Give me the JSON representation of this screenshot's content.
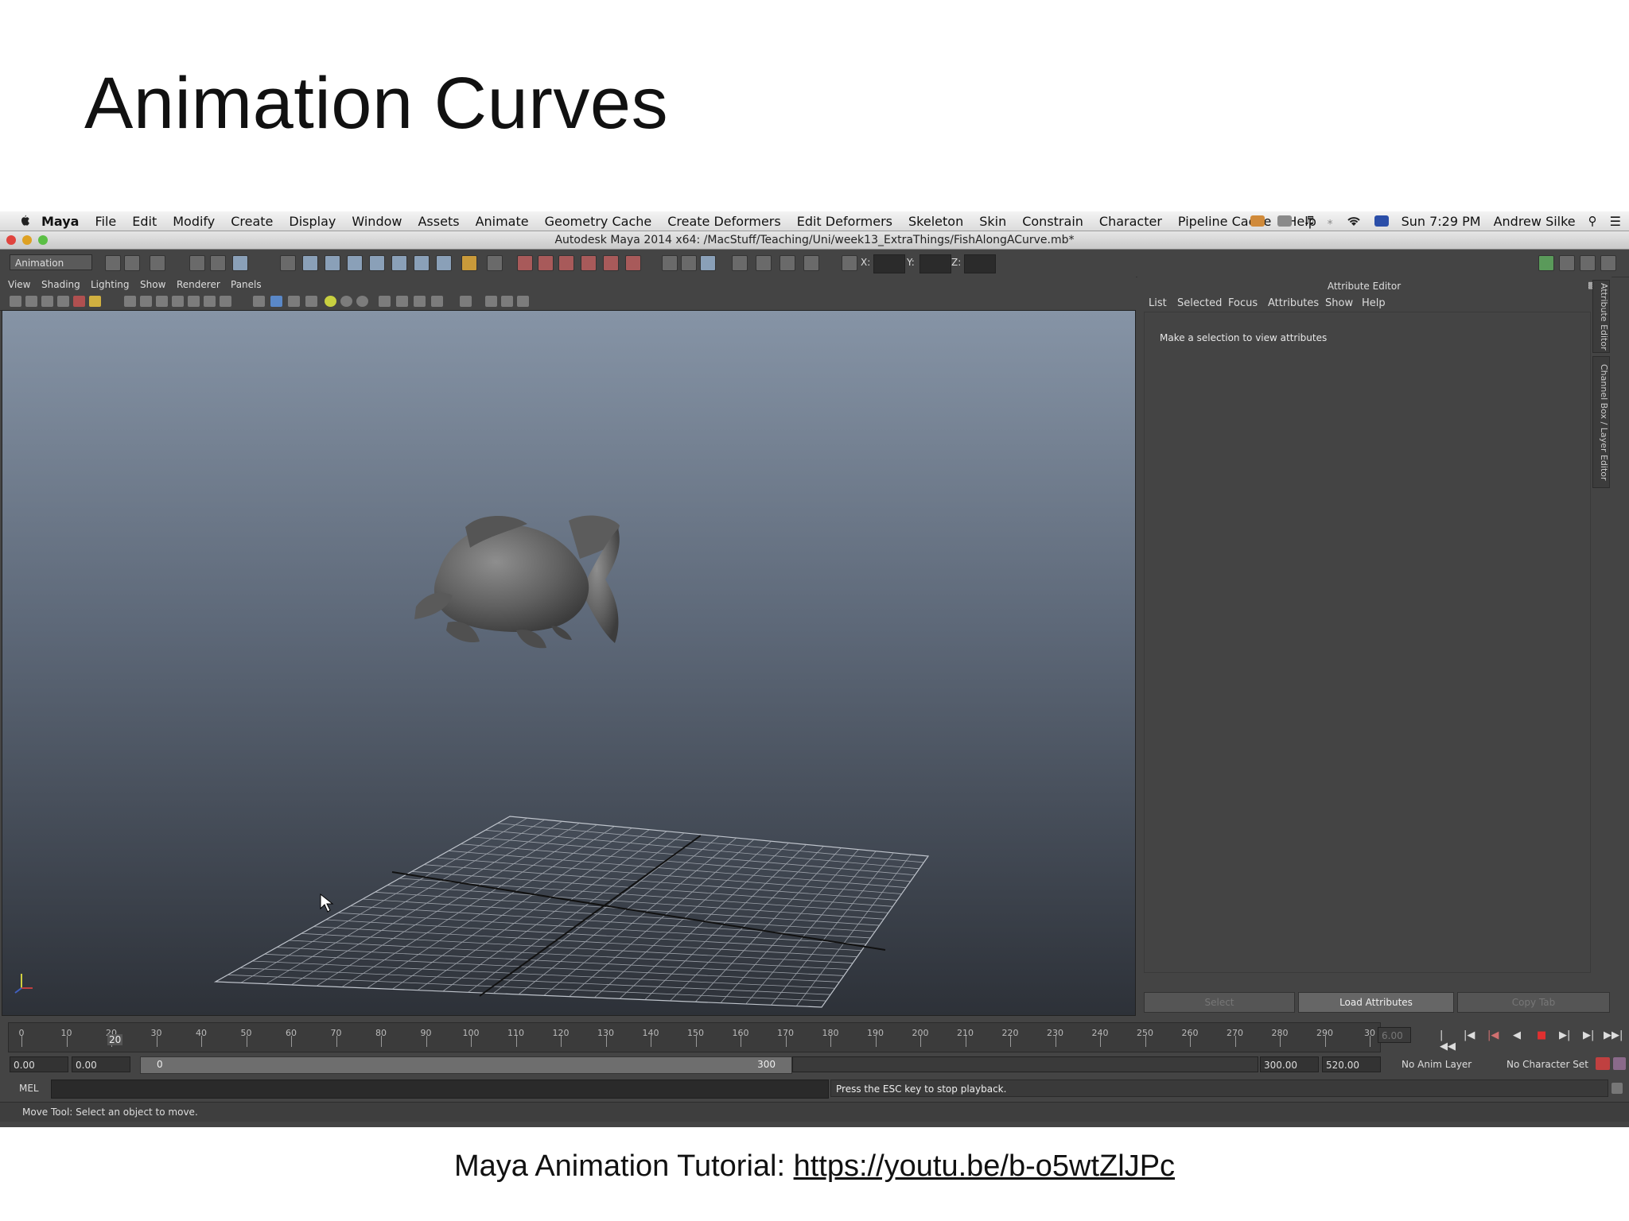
{
  "slide": {
    "title": "Animation Curves",
    "caption_prefix": "Maya Animation Tutorial: ",
    "caption_link": "https://youtu.be/b-o5wtZlJPc"
  },
  "mac_menu": {
    "app": "Maya",
    "items": [
      "File",
      "Edit",
      "Modify",
      "Create",
      "Display",
      "Window",
      "Assets",
      "Animate",
      "Geometry Cache",
      "Create Deformers",
      "Edit Deformers",
      "Skeleton",
      "Skin",
      "Constrain",
      "Character",
      "Pipeline Cache",
      "Help"
    ],
    "clock": "Sun 7:29 PM",
    "user": "Andrew Silke"
  },
  "window_title": "Autodesk Maya 2014 x64: /MacStuff/Teaching/Uni/week13_ExtraThings/FishAlongACurve.mb*",
  "toolbar": {
    "mode": "Animation",
    "x_label": "X:",
    "y_label": "Y:",
    "z_label": "Z:"
  },
  "panel_menu": [
    "View",
    "Shading",
    "Lighting",
    "Show",
    "Renderer",
    "Panels"
  ],
  "attribute_editor": {
    "title": "Attribute Editor",
    "menu": [
      "List",
      "Selected",
      "Focus",
      "Attributes",
      "Show",
      "Help"
    ],
    "message": "Make a selection to view attributes",
    "buttons": {
      "select": "Select",
      "load": "Load Attributes",
      "copy": "Copy Tab"
    },
    "side_tabs": [
      "Attribute Editor",
      "Channel Box / Layer Editor"
    ]
  },
  "timeline": {
    "ticks": [
      "0",
      "10",
      "20",
      "30",
      "40",
      "50",
      "60",
      "70",
      "80",
      "90",
      "100",
      "110",
      "120",
      "130",
      "140",
      "150",
      "160",
      "170",
      "180",
      "190",
      "200",
      "210",
      "220",
      "230",
      "240",
      "250",
      "260",
      "270",
      "280",
      "290",
      "30"
    ],
    "current_frame": "20",
    "current_field": "6.00"
  },
  "range": {
    "start": "0.00",
    "anim_start": "0.00",
    "slider_start": "0",
    "slider_end": "300",
    "anim_end": "300.00",
    "end": "520.00",
    "anim_layer": "No Anim Layer",
    "char_set": "No Character Set"
  },
  "command_line": {
    "label": "MEL",
    "output": "Press the ESC key to stop playback."
  },
  "help_line": "Move Tool: Select an object to move.",
  "colors": {
    "maya_panel": "#444444",
    "viewport_top": "#8694a6",
    "viewport_bottom": "#2d3138"
  }
}
